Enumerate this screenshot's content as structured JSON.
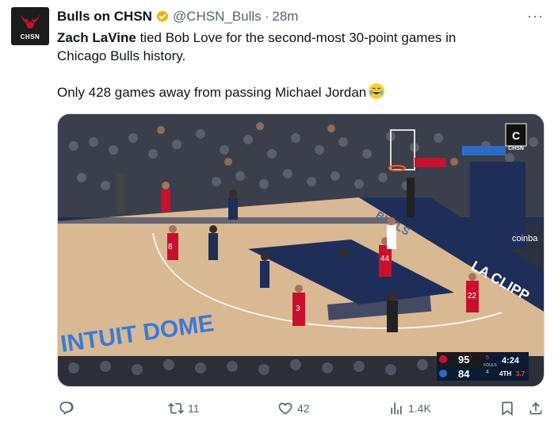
{
  "account": {
    "display_name": "Bulls on CHSN",
    "handle": "@CHSN_Bulls",
    "separator": "·",
    "time": "28m",
    "avatar_text": "CHSN"
  },
  "tweet": {
    "mention": "Zach LaVine",
    "line1_rest": " tied Bob Love for the second-most 30-point games in",
    "line2": "Chicago Bulls history.",
    "line3": "Only 428 games away from passing Michael Jordan"
  },
  "media": {
    "network_bug": "CHSN",
    "scoreboard": {
      "home_score": "95",
      "away_score": "84",
      "fouls_home": "5",
      "fouls_label": "FOULS",
      "fouls_away": "4",
      "clock": "4:24",
      "quarter": "4TH",
      "shot_clock": "3.7"
    },
    "jerseys": [
      "8",
      "44",
      "3",
      "22"
    ],
    "court_text": "LA CLIPP",
    "baseline_text": "INTUIT DOME",
    "sponsor": "coinba"
  },
  "actions": {
    "reply_count": "",
    "repost_count": "11",
    "like_count": "42",
    "views_count": "1.4K"
  },
  "colors": {
    "text": "#0f1419",
    "secondary": "#536471",
    "verified": "#e2b719",
    "court_dark": "#1f2e58",
    "bulls_red": "#c8102e"
  }
}
